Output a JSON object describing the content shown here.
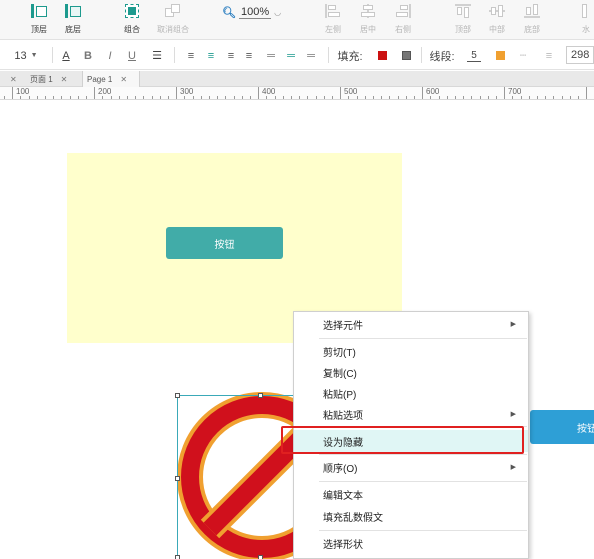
{
  "toolbar": {
    "bring_front": "顶层",
    "send_back": "底层",
    "group": "组合",
    "ungroup": "取消组合",
    "zoom": "100%",
    "align_left": "左侧",
    "align_center": "居中",
    "align_right": "右侧",
    "align_top": "顶部",
    "align_middle": "中部",
    "align_bottom": "底部",
    "distribute": "水"
  },
  "format_bar": {
    "font_size": "13",
    "fill_label": "填充:",
    "fill_color": "#cc1111",
    "stroke_label": "线段:",
    "stroke_width": "5",
    "stroke_color": "#f0a030",
    "coord": "298",
    "bold": "B",
    "italic": "I",
    "underline": "U",
    "text_color": "A"
  },
  "tabs": [
    {
      "label": "页面 1"
    },
    {
      "label": "Page 1"
    }
  ],
  "ruler": [
    "100",
    "200",
    "300",
    "400",
    "500",
    "600",
    "700"
  ],
  "canvas": {
    "teal_button_label": "按钮",
    "blue_button_label": "按钮"
  },
  "context_menu": {
    "items": [
      {
        "label": "选择元件",
        "has_submenu": true
      },
      {
        "label": "剪切(T)"
      },
      {
        "label": "复制(C)"
      },
      {
        "label": "粘贴(P)"
      },
      {
        "label": "粘贴选项",
        "has_submenu": true
      },
      {
        "label": "设为隐藏",
        "highlighted": true
      },
      {
        "label": "顺序(O)",
        "has_submenu": true
      },
      {
        "label": "编辑文本"
      },
      {
        "label": "填充乱数假文"
      },
      {
        "label": "选择形状"
      }
    ]
  },
  "colors": {
    "accent_teal": "#41aca8",
    "highlight_box": "#e02020",
    "canvas_panel": "#ffffcc",
    "blue_button": "#2e9fd6"
  }
}
